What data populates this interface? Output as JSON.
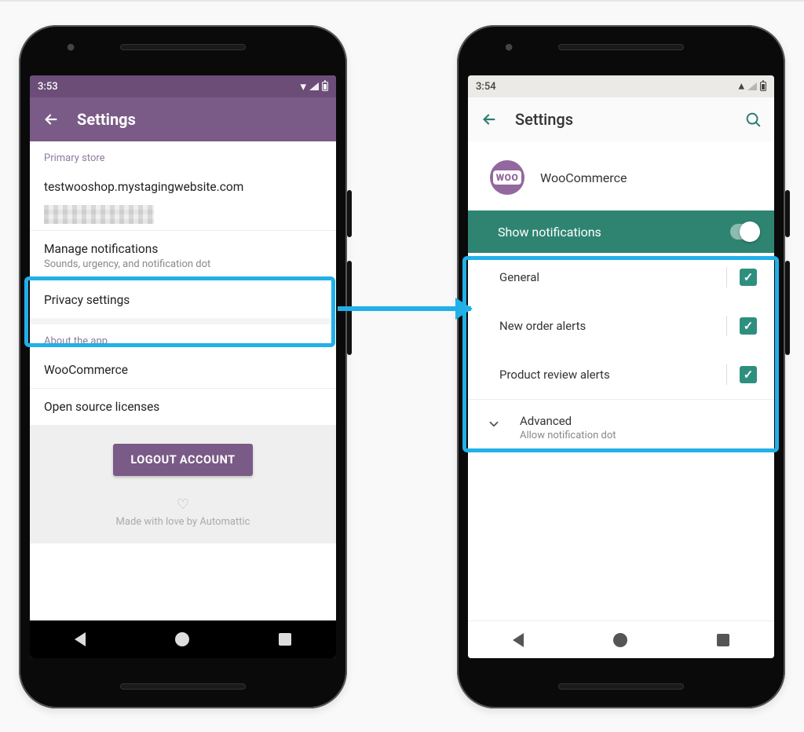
{
  "left": {
    "status_time": "3:53",
    "appbar_title": "Settings",
    "section_primary": "Primary store",
    "store_url": "testwooshop.mystagingwebsite.com",
    "manage_title": "Manage notifications",
    "manage_sub": "Sounds, urgency, and notification dot",
    "privacy": "Privacy settings",
    "section_about": "About the app",
    "about_app": "WooCommerce",
    "licenses": "Open source licenses",
    "logout": "LOGOUT ACCOUNT",
    "love": "Made with love by Automattic"
  },
  "right": {
    "status_time": "3:54",
    "appbar_title": "Settings",
    "app_name": "WooCommerce",
    "woo_badge": "WOO",
    "show_label": "Show notifications",
    "show_on": true,
    "items": {
      "general": "General",
      "orders": "New order alerts",
      "reviews": "Product review alerts"
    },
    "advanced_title": "Advanced",
    "advanced_sub": "Allow notification dot"
  }
}
